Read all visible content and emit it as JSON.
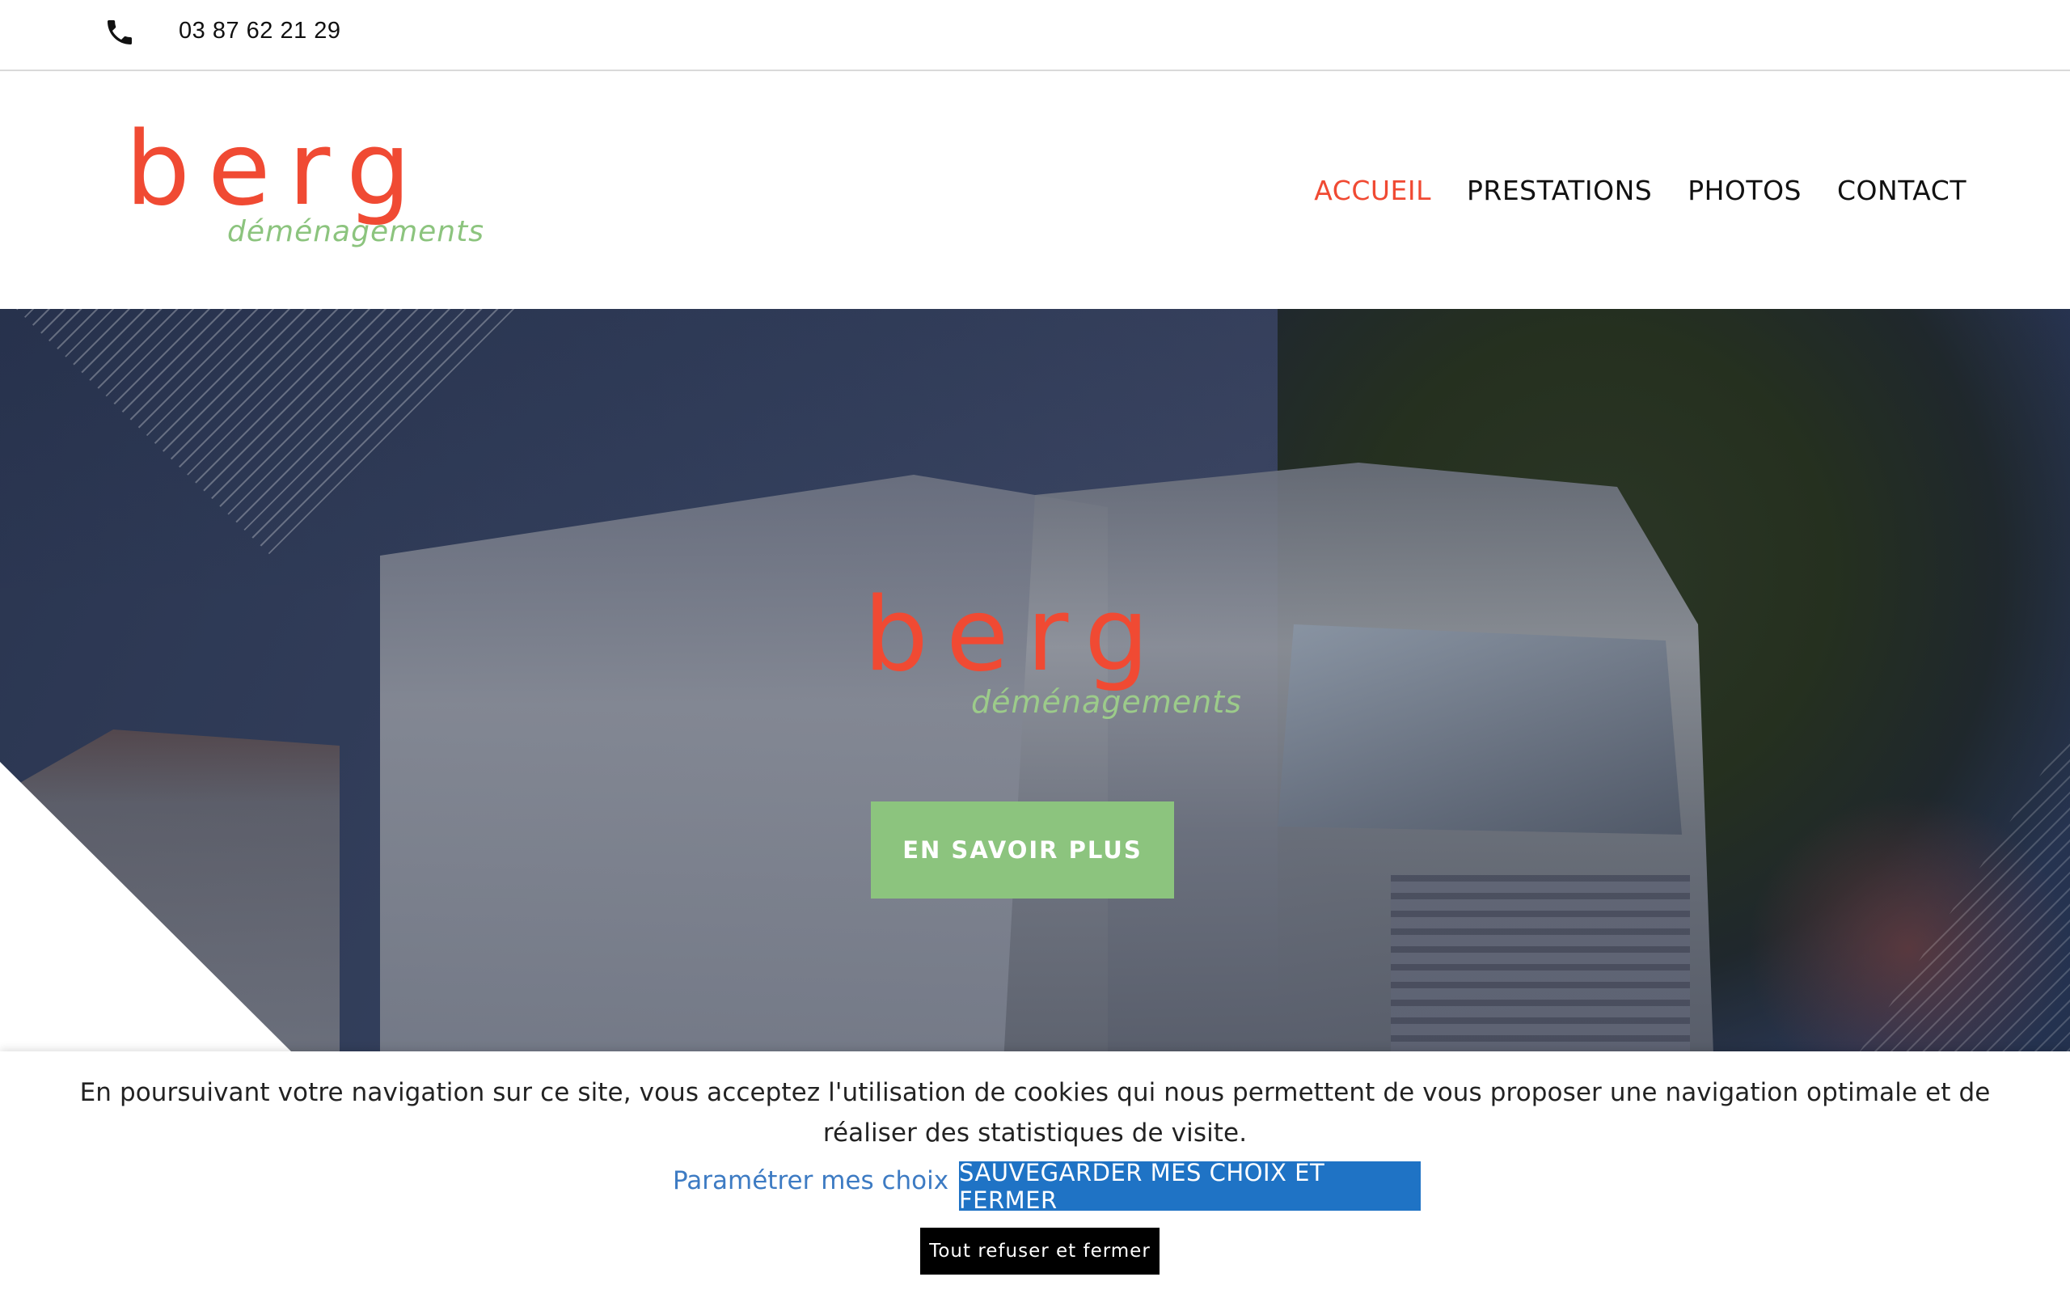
{
  "topbar": {
    "phone_icon": "phone-icon",
    "phone_number": "03 87 62 21 29"
  },
  "header": {
    "logo": {
      "brand": "berg",
      "tagline": "déménagements"
    },
    "nav": [
      {
        "label": "ACCUEIL",
        "active": true
      },
      {
        "label": "PRESTATIONS",
        "active": false
      },
      {
        "label": "PHOTOS",
        "active": false
      },
      {
        "label": "CONTACT",
        "active": false
      }
    ]
  },
  "hero": {
    "logo": {
      "brand": "berg",
      "tagline": "déménagements"
    },
    "cta_label": "EN SAVOIR PLUS"
  },
  "cookie_banner": {
    "message": "En poursuivant votre navigation sur ce site, vous acceptez l'utilisation de cookies qui nous permettent de vous proposer une navigation optimale et de réaliser des statistiques de visite.",
    "settings_link": "Paramétrer mes choix",
    "save_button": "SAUVEGARDER MES CHOIX ET FERMER",
    "refuse_button": "Tout refuser et fermer"
  },
  "colors": {
    "brand_red": "#f04a33",
    "brand_green": "#8cc47e",
    "cookie_blue": "#1f73c5",
    "link_blue": "#3d7bc3"
  }
}
